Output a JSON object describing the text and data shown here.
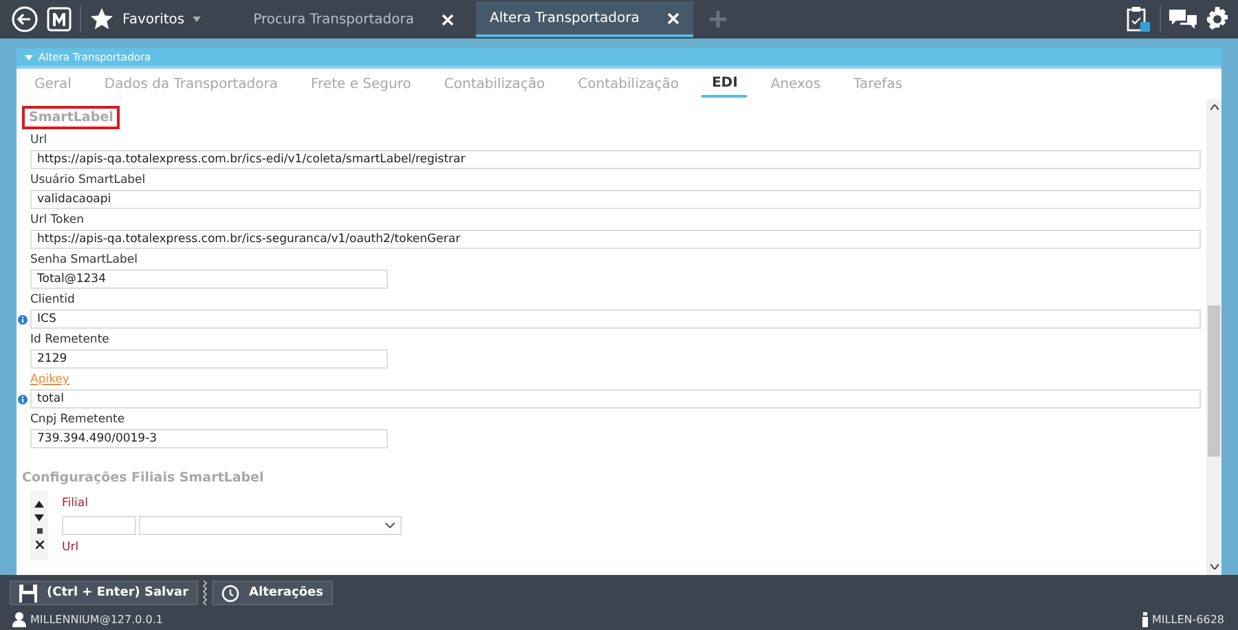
{
  "top_bar": {
    "favorites": "Favoritos",
    "tabs": [
      {
        "label": "Procura Transportadora",
        "selected": false
      },
      {
        "label": "Altera Transportadora",
        "selected": true
      }
    ]
  },
  "panel": {
    "title": "Altera Transportadora"
  },
  "tabs": [
    {
      "label": "Geral",
      "selected": false
    },
    {
      "label": "Dados da Transportadora",
      "selected": false
    },
    {
      "label": "Frete e Seguro",
      "selected": false
    },
    {
      "label": "Contabilização",
      "selected": false
    },
    {
      "label": "Contabilização",
      "selected": false
    },
    {
      "label": "EDI",
      "selected": true
    },
    {
      "label": "Anexos",
      "selected": false
    },
    {
      "label": "Tarefas",
      "selected": false
    }
  ],
  "section": {
    "title": "SmartLabel",
    "highlighted": true
  },
  "fields": [
    {
      "label": "Url",
      "value": "https://apis-qa.totalexpress.com.br/ics-edi/v1/coleta/smartLabel/registrar",
      "kind": "wide",
      "info": false,
      "link": false
    },
    {
      "label": "Usuário SmartLabel",
      "value": "validacaoapi",
      "kind": "wide",
      "info": false,
      "link": false
    },
    {
      "label": "Url Token",
      "value": "https://apis-qa.totalexpress.com.br/ics-seguranca/v1/oauth2/tokenGerar",
      "kind": "wide",
      "info": false,
      "link": false
    },
    {
      "label": "Senha SmartLabel",
      "value": "Total@1234",
      "kind": "short",
      "info": false,
      "link": false
    },
    {
      "label": "Clientid",
      "value": "ICS",
      "kind": "wide",
      "info": true,
      "link": false
    },
    {
      "label": "Id Remetente",
      "value": "2129",
      "kind": "short",
      "info": false,
      "link": false
    },
    {
      "label": "Apikey",
      "value": "total",
      "kind": "wide",
      "info": true,
      "link": true
    },
    {
      "label": "Cnpj Remetente",
      "value": "739.394.490/0019-3",
      "kind": "short",
      "info": false,
      "link": false
    }
  ],
  "branches": {
    "title": "Configurações Filiais SmartLabel",
    "fields": [
      {
        "label": "Filial",
        "required": true
      },
      {
        "label": "Url",
        "required": true
      }
    ]
  },
  "toolbar": {
    "buttons": [
      "(Ctrl + Enter) Salvar",
      "Alterações"
    ]
  },
  "status_bar": {
    "user": "MILLENNIUM@127.0.0.1",
    "machine": "MILLEN-6628"
  }
}
